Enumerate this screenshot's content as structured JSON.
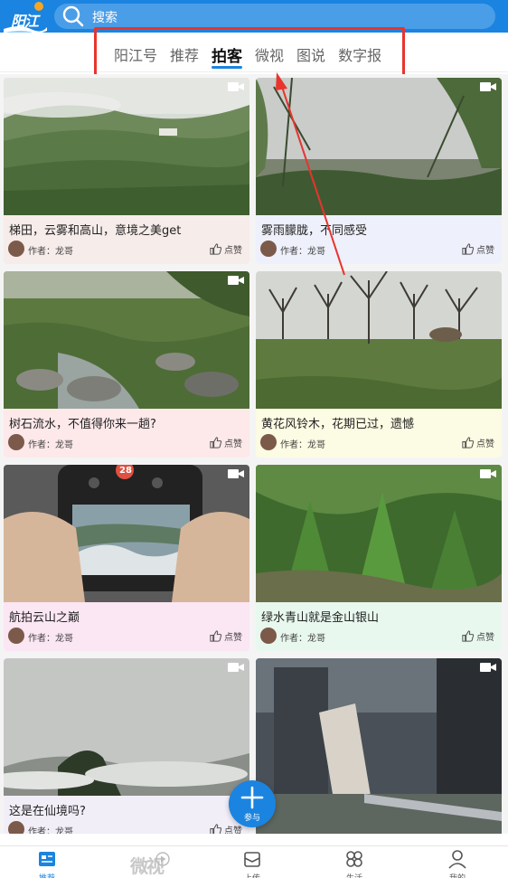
{
  "header": {
    "logo_text": "阳江",
    "search_placeholder": "搜索"
  },
  "tabs": [
    {
      "label": "阳江号",
      "active": false
    },
    {
      "label": "推荐",
      "active": false
    },
    {
      "label": "拍客",
      "active": true
    },
    {
      "label": "微视",
      "active": false
    },
    {
      "label": "图说",
      "active": false
    },
    {
      "label": "数字报",
      "active": false
    }
  ],
  "feed": {
    "items": [
      {
        "title": "梯田，云雾和高山，意境之美get",
        "author_label": "作者：",
        "author": "龙哥",
        "like": "点赞"
      },
      {
        "title": "雾雨朦胧，不同感受",
        "author_label": "作者：",
        "author": "龙哥",
        "like": "点赞"
      },
      {
        "title": "树石流水，不值得你来一趟?",
        "author_label": "作者：",
        "author": "龙哥",
        "like": "点赞"
      },
      {
        "title": "黄花风铃木，花期已过，遗憾",
        "author_label": "作者：",
        "author": "龙哥",
        "like": "点赞"
      },
      {
        "title": "航拍云山之巅",
        "author_label": "作者：",
        "author": "龙哥",
        "like": "点赞",
        "controller_badge": "28"
      },
      {
        "title": "绿水青山就是金山银山",
        "author_label": "作者：",
        "author": "龙哥",
        "like": "点赞"
      },
      {
        "title": "这是在仙境吗?",
        "author_label": "作者：",
        "author": "龙哥",
        "like": "点赞"
      }
    ]
  },
  "fab": {
    "label": "参与"
  },
  "bottom_nav": [
    {
      "label": "推荐",
      "icon": "news-icon",
      "active": true
    },
    {
      "label": "微视",
      "icon": "weishi-logo",
      "active": false
    },
    {
      "label": "上传",
      "icon": "upload-icon",
      "active": false
    },
    {
      "label": "生活",
      "icon": "life-icon",
      "active": false
    },
    {
      "label": "我的",
      "icon": "user-icon",
      "active": false
    }
  ],
  "colors": {
    "brand_blue": "#1a84e0",
    "annotation_red": "#e8342d"
  }
}
